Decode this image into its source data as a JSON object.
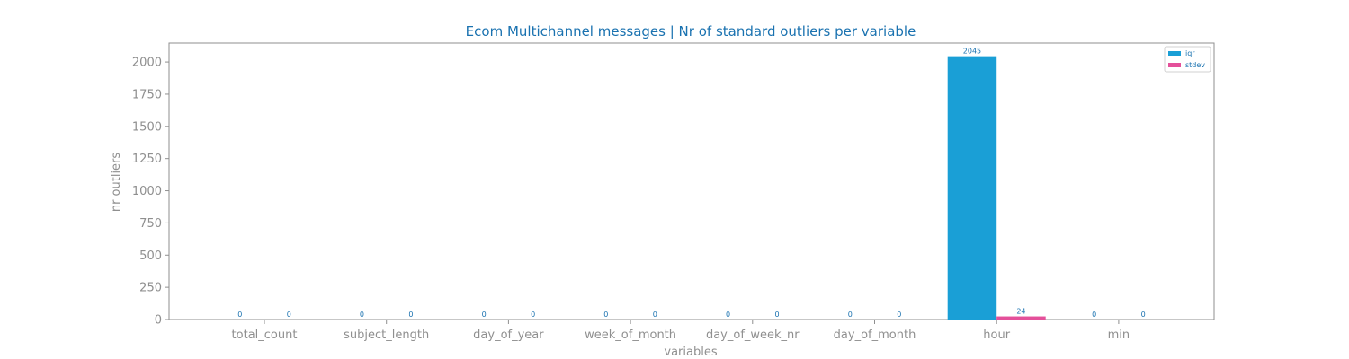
{
  "chart_data": {
    "type": "bar",
    "title": "Ecom Multichannel messages | Nr of standard outliers per variable",
    "xlabel": "variables",
    "ylabel": "nr outliers",
    "categories": [
      "total_count",
      "subject_length",
      "day_of_year",
      "week_of_month",
      "day_of_week_nr",
      "day_of_month",
      "hour",
      "min"
    ],
    "series": [
      {
        "name": "iqr",
        "color": "#1a9fd6",
        "values": [
          0,
          0,
          0,
          0,
          0,
          0,
          2045,
          0
        ]
      },
      {
        "name": "stdev",
        "color": "#e4509a",
        "values": [
          0,
          0,
          0,
          0,
          0,
          0,
          24,
          0
        ]
      }
    ],
    "yticks": [
      0,
      250,
      500,
      750,
      1000,
      1250,
      1500,
      1750,
      2000
    ],
    "ylim": [
      0,
      2147
    ],
    "grid": false,
    "legend_position": "top-right"
  }
}
